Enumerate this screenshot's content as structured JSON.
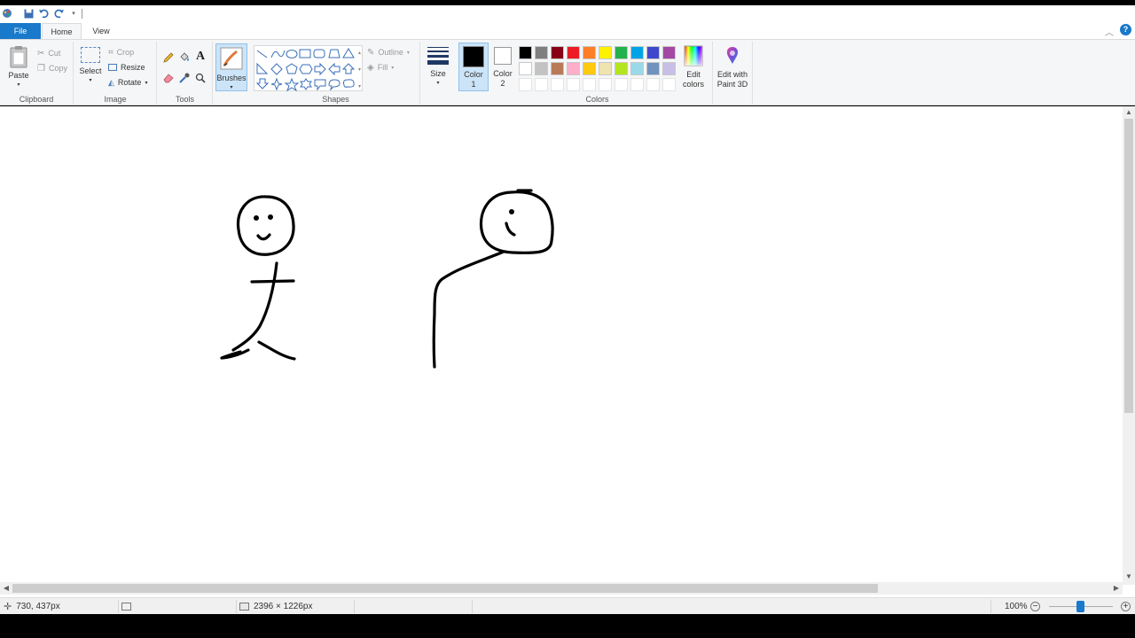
{
  "quick_access": {
    "icons": [
      "paint-app-icon",
      "save-icon",
      "undo-icon",
      "redo-icon",
      "customize-qat-icon"
    ]
  },
  "tabs": {
    "file": "File",
    "home": "Home",
    "view": "View"
  },
  "ribbon": {
    "clipboard": {
      "label": "Clipboard",
      "paste": "Paste",
      "cut": "Cut",
      "copy": "Copy"
    },
    "image": {
      "label": "Image",
      "select": "Select",
      "crop": "Crop",
      "resize": "Resize",
      "rotate": "Rotate"
    },
    "tools": {
      "label": "Tools",
      "items": [
        "pencil-icon",
        "fill-bucket-icon",
        "text-icon",
        "eraser-icon",
        "color-picker-icon",
        "magnifier-icon"
      ]
    },
    "brushes": {
      "label": "Brushes"
    },
    "shapes": {
      "label": "Shapes",
      "outline": "Outline",
      "fill": "Fill"
    },
    "size": {
      "label": "Size"
    },
    "color1": {
      "line1": "Color",
      "line2": "1",
      "value": "#000000"
    },
    "color2": {
      "line1": "Color",
      "line2": "2",
      "value": "#ffffff"
    },
    "colors": {
      "label": "Colors",
      "row1": [
        "#000000",
        "#7f7f7f",
        "#880015",
        "#ed1c24",
        "#ff7f27",
        "#fff200",
        "#22b14c",
        "#00a2e8",
        "#3f48cc",
        "#a349a4"
      ],
      "row2": [
        "#ffffff",
        "#c3c3c3",
        "#b97a57",
        "#ffaec9",
        "#ffc90e",
        "#efe4b0",
        "#b5e61d",
        "#99d9ea",
        "#7092be",
        "#c8bfe7"
      ],
      "row3_count": 10
    },
    "edit_colors": {
      "line1": "Edit",
      "line2": "colors"
    },
    "paint3d": {
      "line1": "Edit with",
      "line2": "Paint 3D"
    }
  },
  "canvas": {
    "drawing": "stick figures"
  },
  "status": {
    "cursor": "730, 437px",
    "dimensions": "2396 × 1226px",
    "zoom": "100%",
    "zoom_level": 1.0
  }
}
